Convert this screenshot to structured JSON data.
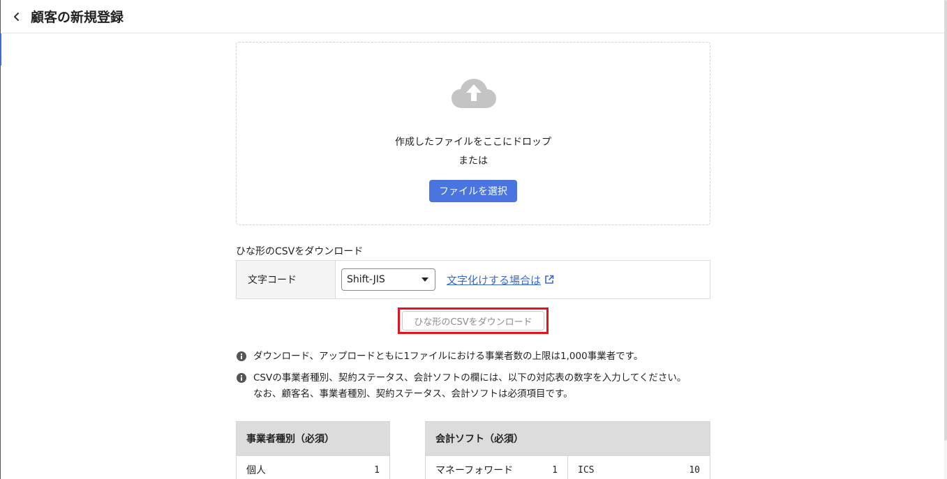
{
  "header": {
    "back_icon": "chevron-left-icon",
    "title": "顧客の新規登録"
  },
  "upload": {
    "icon": "cloud-upload-icon",
    "drop_text": "作成したファイルをここにドロップ",
    "or_text": "または",
    "select_button": "ファイルを選択",
    "colors": {
      "button": "#4a74e0",
      "icon": "#c4c4c4"
    }
  },
  "template": {
    "heading": "ひな形のCSVをダウンロード",
    "encoding_label": "文字コード",
    "encoding_value": "Shift-JIS",
    "garble_link": "文字化けする場合は",
    "external_icon": "external-link-icon",
    "download_button": "ひな形のCSVをダウンロード",
    "highlight_color": "#e0141a"
  },
  "notes": [
    {
      "icon": "info-icon",
      "lines": [
        "ダウンロード、アップロードともに1ファイルにおける事業者数の上限は1,000事業者です。"
      ]
    },
    {
      "icon": "info-icon",
      "lines": [
        "CSVの事業者種別、契約ステータス、会計ソフトの欄には、以下の対応表の数字を入力してください。",
        "なお、顧客名、事業者種別、契約ステータス、会計ソフトは必須項目です。"
      ]
    }
  ],
  "business_type_table": {
    "header": "事業者種別（必須）",
    "rows": [
      {
        "label": "個人",
        "code": "1"
      }
    ]
  },
  "accounting_software_table": {
    "header": "会計ソフト（必須）",
    "rows": [
      [
        {
          "label": "マネーフォワード",
          "code": "1"
        },
        {
          "label": "ICS",
          "code": "10"
        }
      ]
    ]
  }
}
